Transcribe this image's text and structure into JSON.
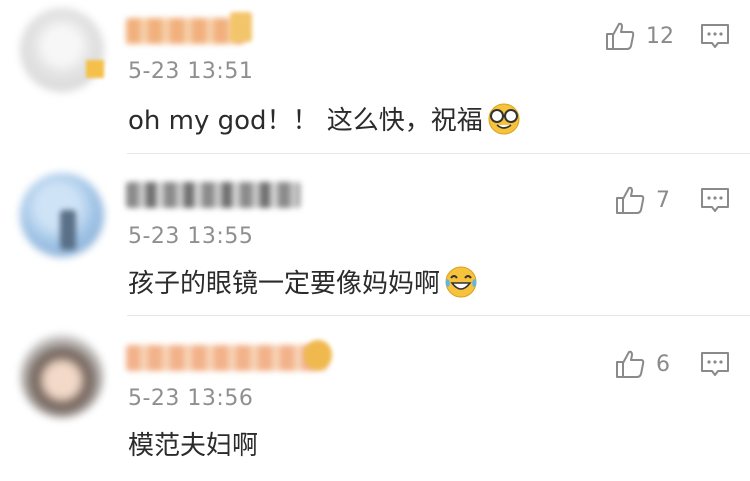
{
  "comments": [
    {
      "time": "5-23 13:51",
      "text": "oh my god！！ 这么快，祝福",
      "emoji": "glasses-grin-emoji",
      "likes": "12"
    },
    {
      "time": "5-23 13:55",
      "text": "孩子的眼镜一定要像妈妈啊",
      "emoji": "tears-of-joy-emoji",
      "likes": "7"
    },
    {
      "time": "5-23 13:56",
      "text": "模范夫妇啊",
      "emoji": "",
      "likes": "6"
    }
  ],
  "icons": {
    "like": "thumbs-up-icon",
    "reply": "comment-icon"
  },
  "colors": {
    "meta_text": "#8f8f8f",
    "body_text": "#2b2b2b",
    "icon": "#8a8a8a",
    "emoji_yellow": "#f7c23c"
  }
}
